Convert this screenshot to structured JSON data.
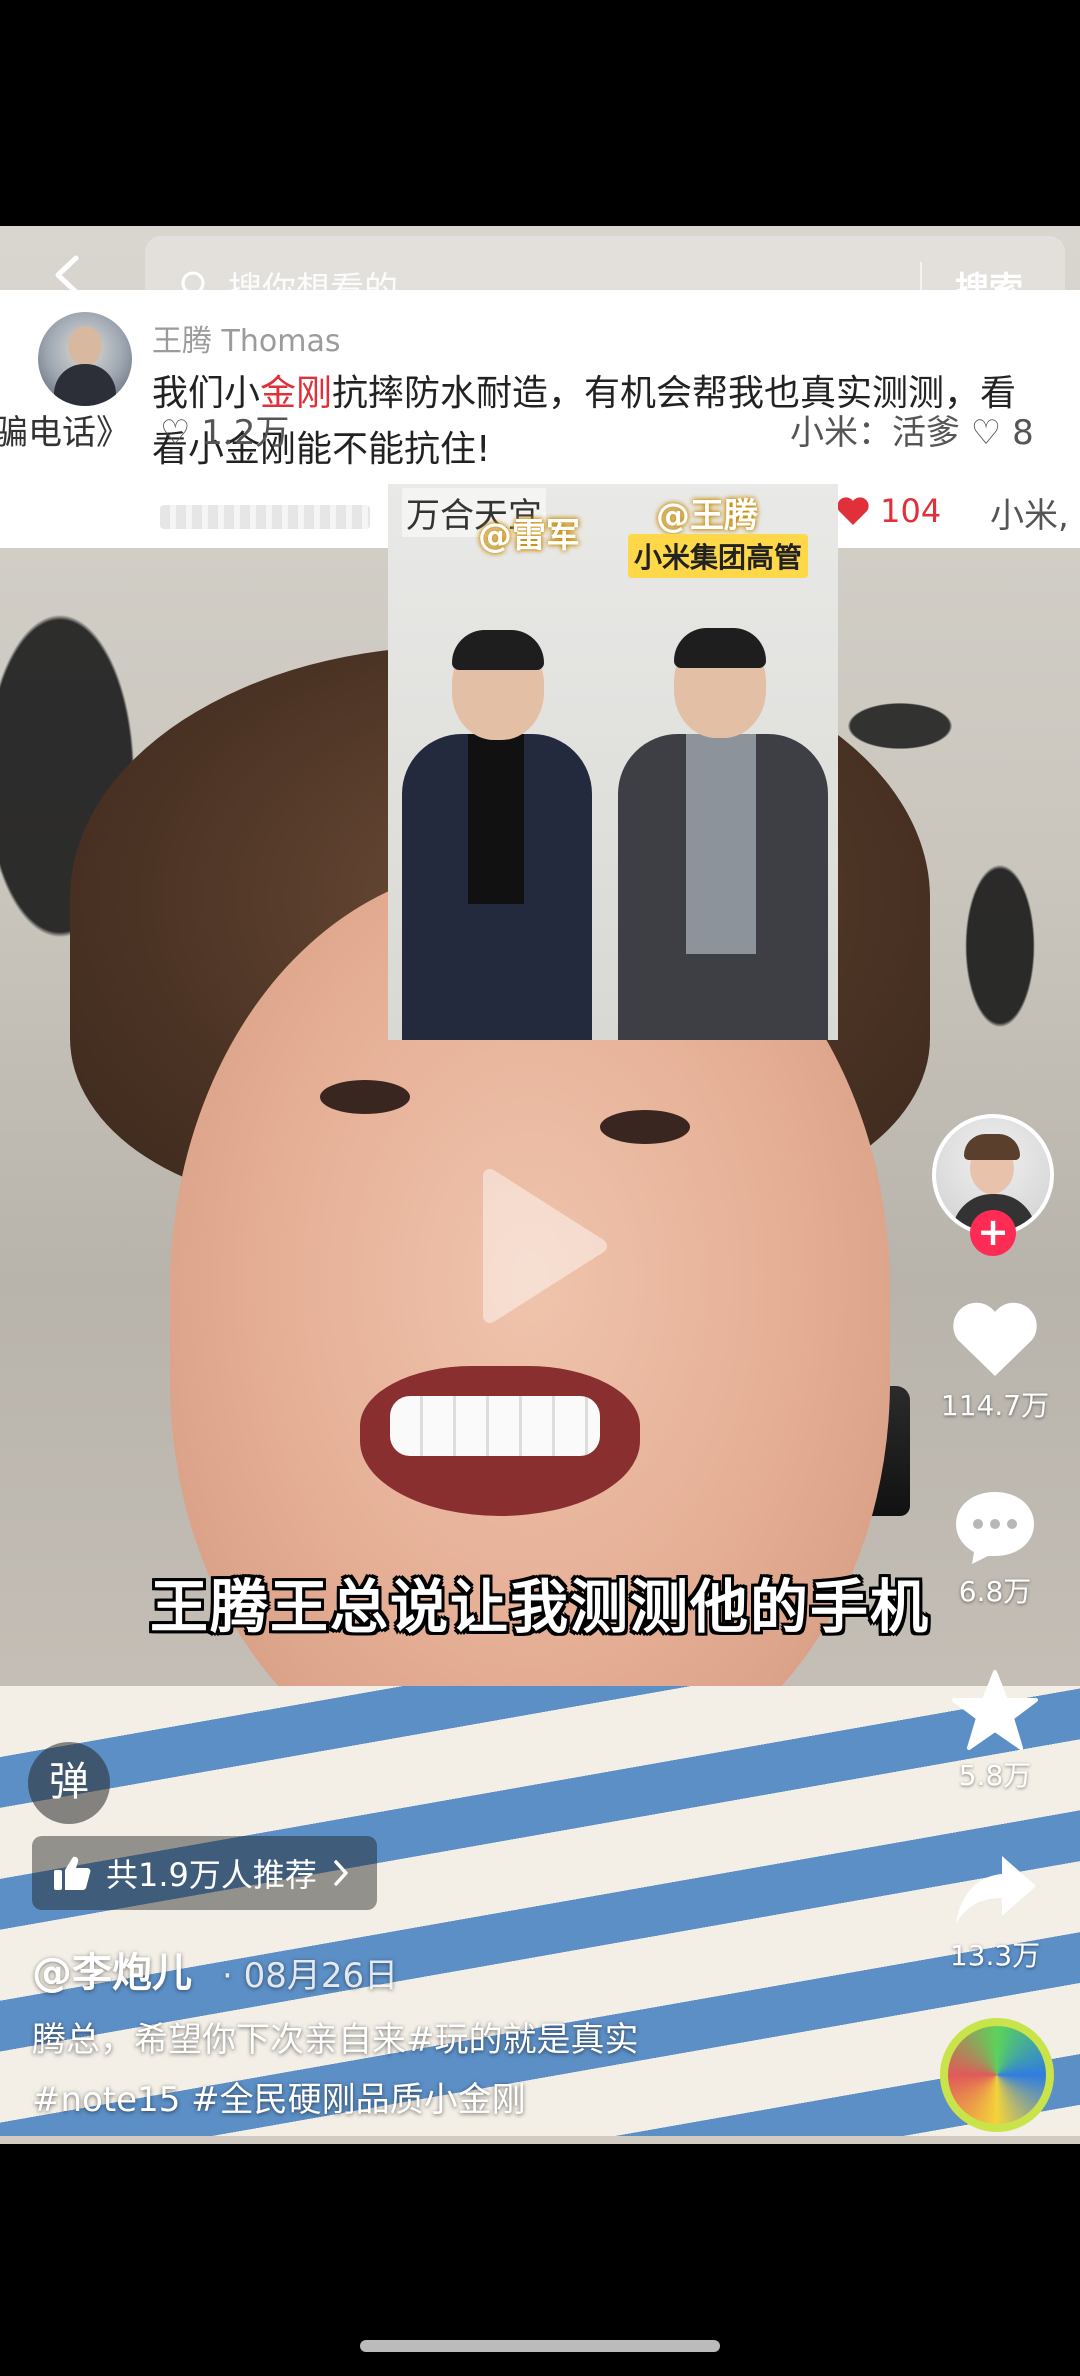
{
  "search": {
    "placeholder": "搜你想看的",
    "button": "搜索"
  },
  "comment_overlay": {
    "user": "王腾 Thomas",
    "text_before": "我们小",
    "text_red": "金刚",
    "text_after": "抗摔防水耐造，有机会帮我也真实测测，看看小金刚能不能抗住!",
    "left_fragment": "骗电话》",
    "left_likes": "♡ 1.2万",
    "right_fragment": "小米：活爹 ♡ 8",
    "right_likes": "104",
    "right_fragment2": "小米,"
  },
  "photo": {
    "top_text": "万合天宜",
    "tag_left": "@雷军",
    "tag_right": "@王腾",
    "tag_right_sub": "小米集团高管"
  },
  "rail": {
    "likes": "114.7万",
    "comments": "6.8万",
    "favorites": "5.8万",
    "shares": "13.3万",
    "follow_symbol": "+"
  },
  "subtitle": "王腾王总说让我测测他的手机",
  "bottom": {
    "danmu": "弹",
    "recommend": "共1.9万人推荐",
    "author": "@李炮儿",
    "date": "· 08月26日",
    "desc_line1": "腾总，希望你下次亲自来#玩的就是真实",
    "desc_line2": "#note15 #全民硬刚品质小金刚"
  },
  "colors": {
    "accent_red": "#fe2c55",
    "highlight_red": "#e0303a"
  }
}
